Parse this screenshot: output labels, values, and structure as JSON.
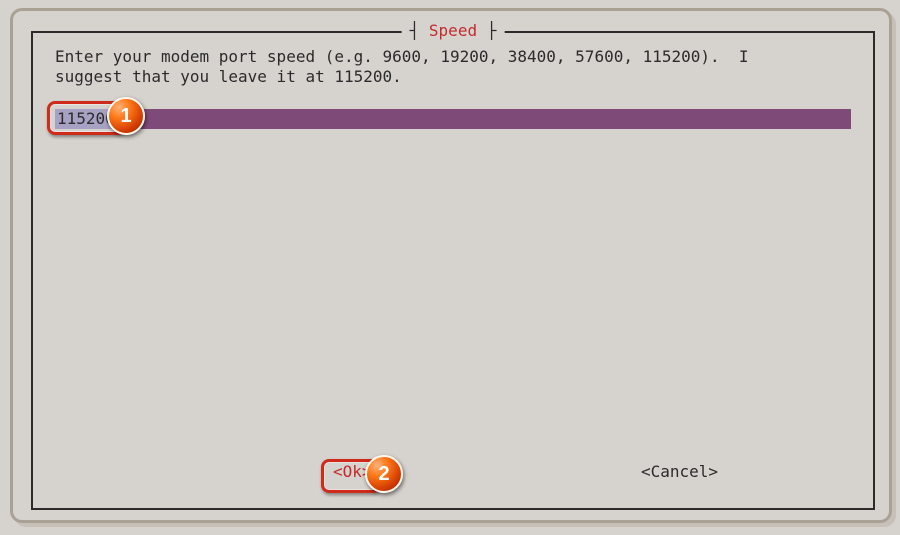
{
  "dialog": {
    "title": "Speed",
    "prompt": "Enter your modem port speed (e.g. 9600, 19200, 38400, 57600, 115200).  I\nsuggest that you leave it at 115200.",
    "input_value": "115200",
    "ok_label": "<Ok>",
    "cancel_label": "<Cancel>"
  },
  "annotations": {
    "1": "1",
    "2": "2"
  }
}
